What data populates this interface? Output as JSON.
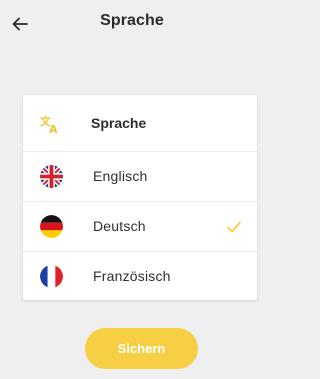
{
  "header": {
    "title": "Sprache",
    "back_icon": "arrow-left-icon"
  },
  "card": {
    "header_icon": "translate-icon",
    "header_label": "Sprache",
    "languages": [
      {
        "label": "Englisch",
        "flag_icon": "uk-flag-icon",
        "selected": false
      },
      {
        "label": "Deutsch",
        "flag_icon": "germany-flag-icon",
        "selected": true
      },
      {
        "label": "Französisch",
        "flag_icon": "france-flag-icon",
        "selected": false
      }
    ]
  },
  "save_button": {
    "label": "Sichern"
  },
  "colors": {
    "accent": "#f6cf45",
    "check": "#f6cf45",
    "background": "#efefef",
    "text": "#2b2b2b"
  }
}
